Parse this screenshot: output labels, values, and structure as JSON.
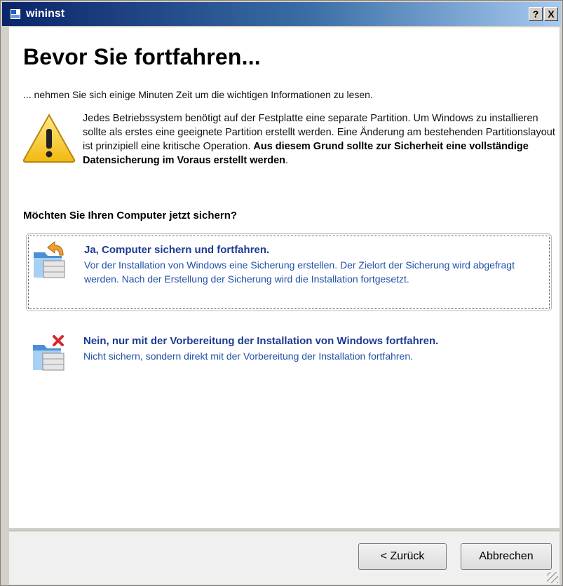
{
  "window": {
    "title": "wininst",
    "help_label": "?",
    "close_label": "X"
  },
  "page": {
    "heading": "Bevor Sie fortfahren...",
    "intro": "... nehmen Sie sich einige Minuten Zeit um die wichtigen Informationen zu lesen."
  },
  "warning": {
    "icon": "warning-triangle-icon",
    "text_normal": "Jedes Betriebssystem benötigt auf der Festplatte eine separate Partition. Um Windows zu installieren sollte als erstes eine geeignete Partition erstellt werden. Eine Änderung am bestehenden Partitionslayout ist prinzipiell eine kritische Operation. ",
    "text_bold": "Aus diesem Grund sollte zur Sicherheit eine vollständige Datensicherung im Voraus erstellt werden",
    "text_end": "."
  },
  "question": "Möchten Sie Ihren Computer jetzt sichern?",
  "options": [
    {
      "title": "Ja, Computer sichern und fortfahren.",
      "description": "Vor der Installation von Windows eine Sicherung erstellen. Der Zielort der Sicherung wird abgefragt werden. Nach der Erstellung der Sicherung wird die Installation fortgesetzt.",
      "icon": "backup-folder-arrow-icon"
    },
    {
      "title": "Nein, nur mit der Vorbereitung der Installation von Windows fortfahren.",
      "description": "Nicht sichern, sondern direkt mit der Vorbereitung der Installation fortfahren.",
      "icon": "backup-folder-cross-icon"
    }
  ],
  "buttons": {
    "back": "< Zurück",
    "cancel": "Abbrechen"
  },
  "colors": {
    "link_title": "#1d3a93",
    "link_desc": "#1f50a8",
    "titlebar_start": "#0a246a",
    "titlebar_end": "#a6caf0"
  }
}
